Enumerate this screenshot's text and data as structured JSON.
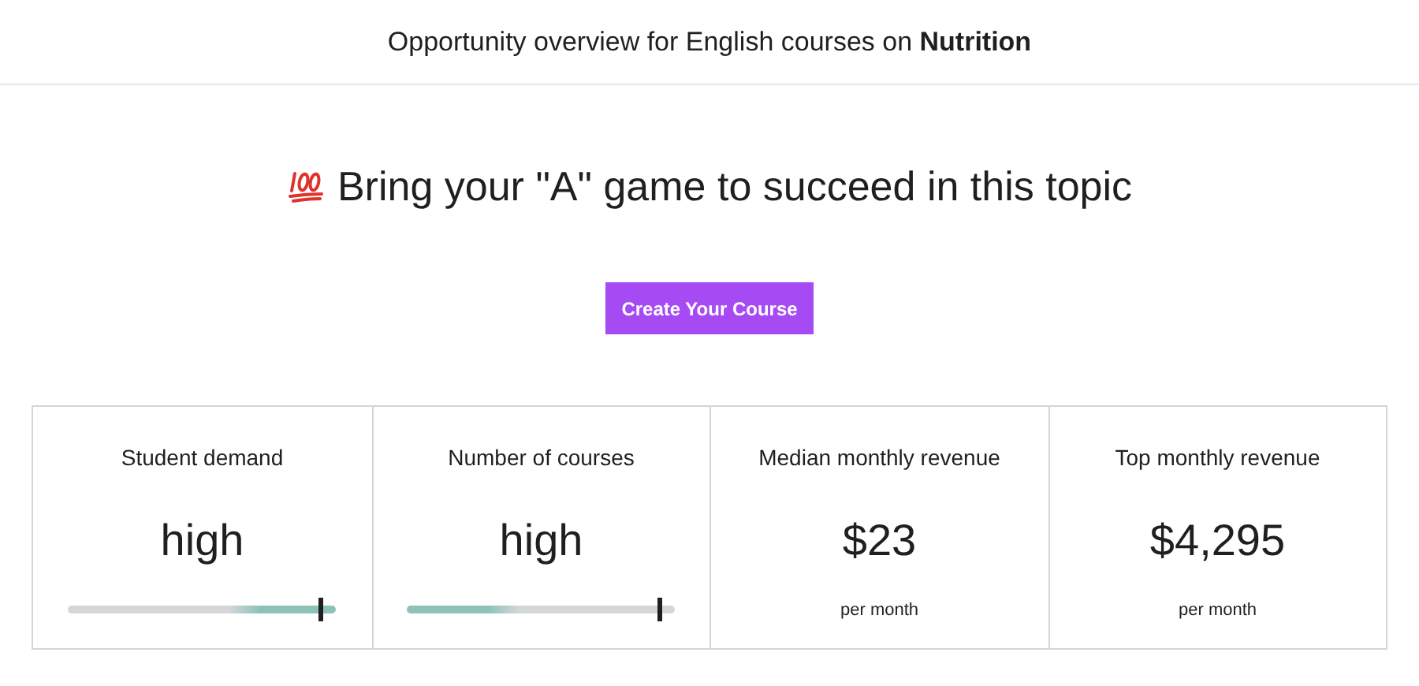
{
  "header": {
    "title": "Opportunity overview for English courses on **Nutrition**"
  },
  "headline": "Bring your \"A\" game to succeed in this topic",
  "button": "Create Your Course",
  "metrics": [
    {
      "kind": "meter",
      "label": "Student demand",
      "value": "high",
      "level": 0.94,
      "fill_from_left": false
    },
    {
      "kind": "meter",
      "label": "Number of courses",
      "value": "high",
      "level": 0.94,
      "fill_from_left": true
    },
    {
      "kind": "amount",
      "label": "Median monthly revenue",
      "value": "$23",
      "note": "per month"
    },
    {
      "kind": "amount",
      "label": "Top monthly revenue",
      "value": "$4,295",
      "note": "per month"
    }
  ]
}
